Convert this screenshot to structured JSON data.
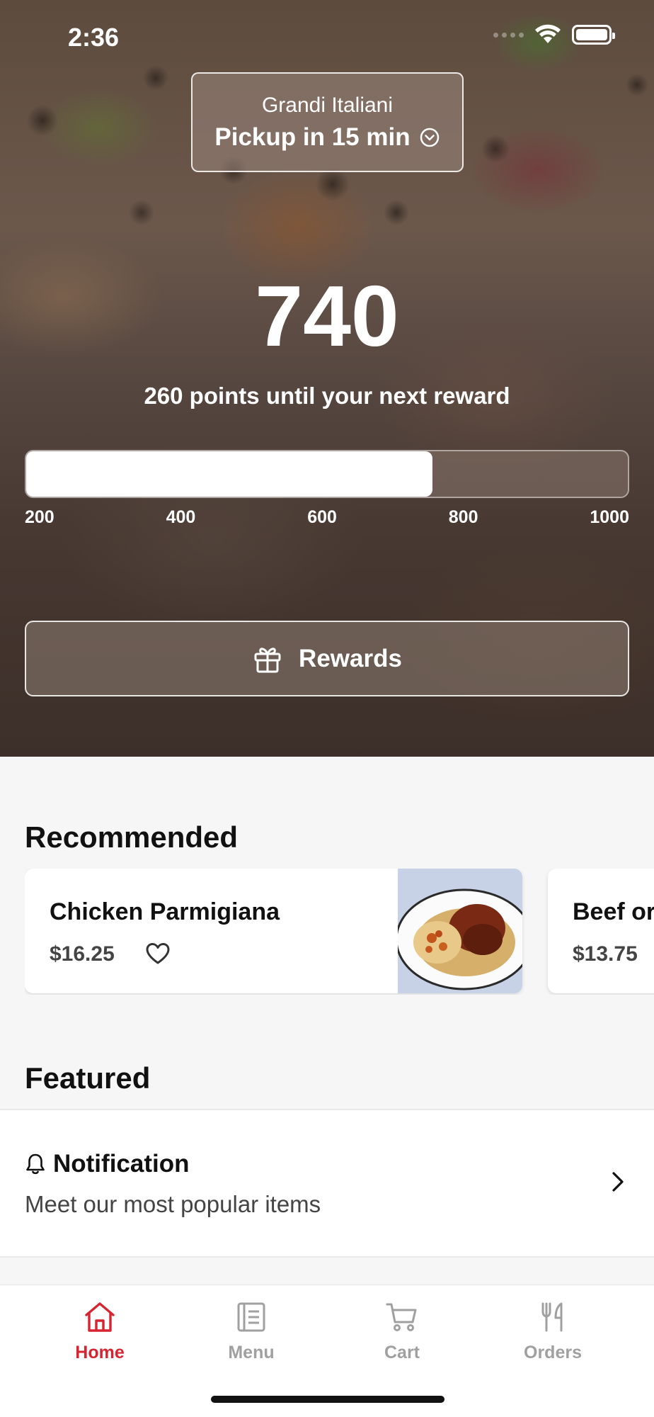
{
  "status": {
    "time": "2:36",
    "icons": [
      "signal-icon",
      "wifi-icon",
      "battery-icon"
    ]
  },
  "location": {
    "name": "Grandi Italiani",
    "pickup": "Pickup in 15 min"
  },
  "points": {
    "value": "740",
    "caption": "260 points until your next reward",
    "progress_value": 740,
    "scale_min": 200,
    "scale_max": 1000,
    "ticks": [
      "200",
      "400",
      "600",
      "800",
      "1000"
    ]
  },
  "rewards": {
    "label": "Rewards"
  },
  "recommended": {
    "title": "Recommended",
    "items": [
      {
        "name": "Chicken Parmigiana",
        "price": "$16.25"
      },
      {
        "name": "Beef or",
        "price": "$13.75"
      }
    ]
  },
  "featured": {
    "title": "Featured",
    "item": {
      "name": "Notification",
      "subtitle": "Meet our most popular items"
    }
  },
  "tabs": [
    {
      "label": "Home",
      "icon": "home-icon",
      "active": true
    },
    {
      "label": "Menu",
      "icon": "menu-icon",
      "active": false
    },
    {
      "label": "Cart",
      "icon": "cart-icon",
      "active": false
    },
    {
      "label": "Orders",
      "icon": "fork-knife-icon",
      "active": false
    }
  ],
  "colors": {
    "accent": "#d62430",
    "inactive_tab": "#a0a0a0"
  }
}
